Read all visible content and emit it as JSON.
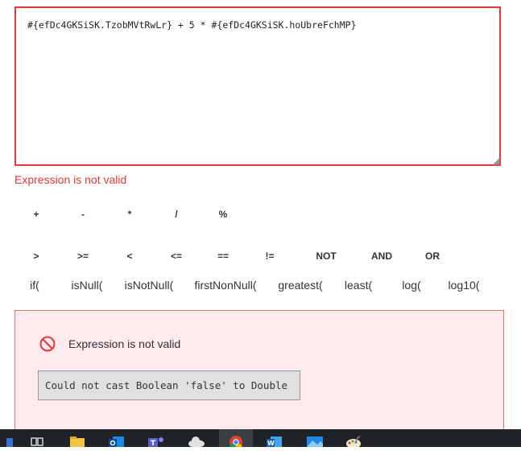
{
  "expression": {
    "value": "#{efDc4GKSiSK.TzobMVtRwLr} + 5 * #{efDc4GKSiSK.hoUbreFchMP}",
    "error": "Expression is not valid"
  },
  "operators_row1": [
    "+",
    "-",
    "*",
    "/",
    "%"
  ],
  "operators_row2": [
    ">",
    ">=",
    "<",
    "<=",
    "==",
    "!=",
    "NOT",
    "AND",
    "OR"
  ],
  "functions": [
    "if(",
    "isNull(",
    "isNotNull(",
    "firstNonNull(",
    "greatest(",
    "least(",
    "log(",
    "log10("
  ],
  "error_panel": {
    "title": "Expression is not valid",
    "detail": "Could not cast Boolean 'false' to Double"
  },
  "taskbar": {
    "icons": [
      "task-view-icon",
      "file-explorer-icon",
      "outlook-icon",
      "teams-icon",
      "onedrive-icon",
      "chrome-icon",
      "word-icon",
      "photos-icon",
      "paint-icon"
    ]
  },
  "colors": {
    "error": "#e53935",
    "error_panel_bg": "#ffebee",
    "taskbar": "#1f2327"
  }
}
